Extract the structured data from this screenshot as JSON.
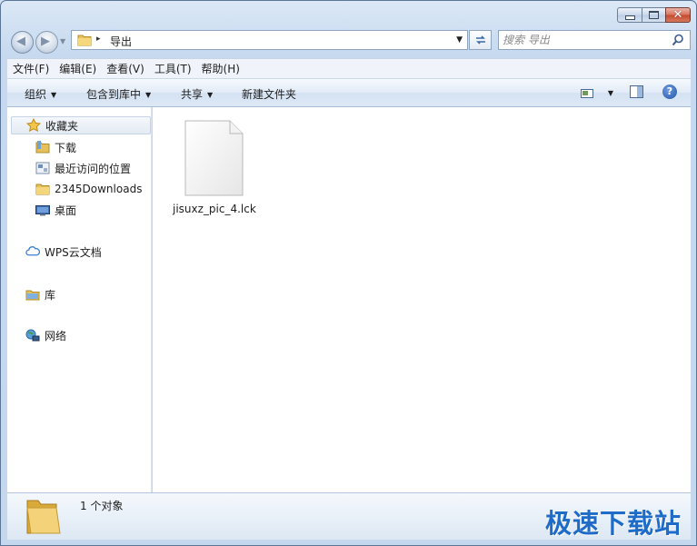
{
  "window": {
    "caption_buttons": {
      "minimize": "minimize",
      "maximize": "maximize",
      "close": "✕"
    }
  },
  "address": {
    "separator": "▸",
    "crumbs": [
      "导出"
    ],
    "dropdown": "▼"
  },
  "search": {
    "placeholder": "搜索 导出",
    "icon": "search-icon"
  },
  "menu": {
    "items": [
      {
        "label": "文件(F)"
      },
      {
        "label": "编辑(E)"
      },
      {
        "label": "查看(V)"
      },
      {
        "label": "工具(T)"
      },
      {
        "label": "帮助(H)"
      }
    ]
  },
  "toolbar": {
    "organize": "组织",
    "include_in_library": "包含到库中",
    "share": "共享",
    "new_folder": "新建文件夹",
    "dropdown_arrow": "▼",
    "help": "?"
  },
  "navigation": {
    "favorites": {
      "label": "收藏夹",
      "icon": "star-icon",
      "items": [
        {
          "label": "下载",
          "icon": "folder-download-icon"
        },
        {
          "label": "最近访问的位置",
          "icon": "recent-places-icon"
        },
        {
          "label": "2345Downloads",
          "icon": "folder-icon"
        },
        {
          "label": "桌面",
          "icon": "desktop-icon"
        }
      ]
    },
    "wps": {
      "label": "WPS云文档",
      "icon": "cloud-icon"
    },
    "libraries": {
      "label": "库",
      "icon": "library-icon"
    },
    "network": {
      "label": "网络",
      "icon": "network-icon"
    }
  },
  "files": [
    {
      "name": "jisuxz_pic_4.lck",
      "icon": "file-icon"
    }
  ],
  "status": {
    "count_text": "1 个对象"
  },
  "watermark": "极速下载站",
  "colors": {
    "accent": "#1e6bc8",
    "frame": "#c6d9ef",
    "selection": "#e4ebf4"
  }
}
